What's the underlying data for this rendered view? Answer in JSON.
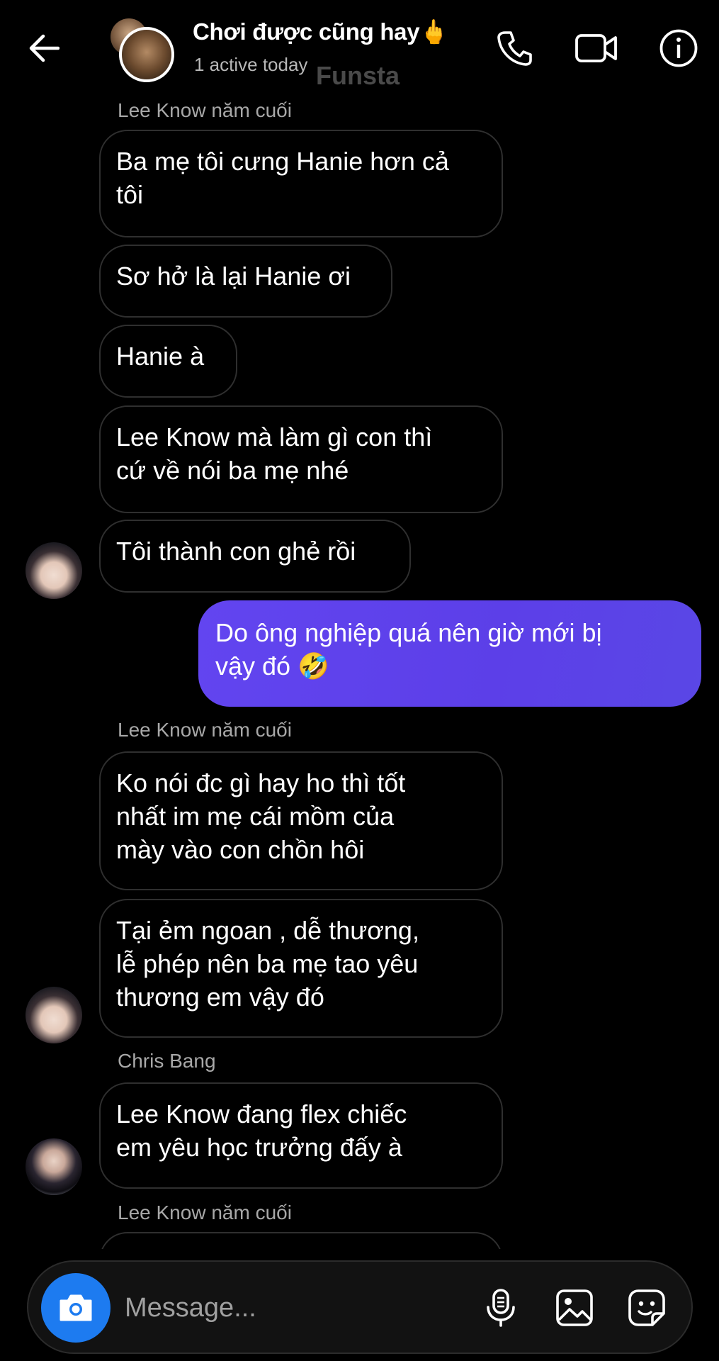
{
  "header": {
    "title": "Chơi được cũng hay🖕",
    "status": "1 active today",
    "watermark": "Funsta"
  },
  "messages": [
    {
      "sender": "Lee Know năm cuối"
    },
    {
      "text": "Ba mẹ tôi cưng Hanie hơn cả\ntôi"
    },
    {
      "text": "Sơ hở là lại Hanie ơi"
    },
    {
      "text": "Hanie à"
    },
    {
      "text": "Lee Know mà làm gì con thì\ncứ về nói ba mẹ nhé"
    },
    {
      "text": "Tôi thành con ghẻ rồi"
    },
    {
      "text": "Do ông nghiệp quá nên giờ mới bị\nvậy đó 🤣"
    },
    {
      "sender": "Lee Know năm cuối"
    },
    {
      "text": "Ko nói đc gì hay ho thì tốt\nnhất im mẹ cái mồm của\nmày vào con chồn hôi"
    },
    {
      "text": "Tại ẻm ngoan , dễ thương,\nlễ phép nên ba mẹ tao yêu\nthương em vậy đó"
    },
    {
      "sender": "Chris Bang"
    },
    {
      "text": "Lee Know đang flex chiếc\nem yêu học trưởng đấy à"
    },
    {
      "sender": "Lee Know năm cuối"
    }
  ],
  "composer": {
    "placeholder": "Message..."
  },
  "colors": {
    "outgoing_bubble": "#5c3fe8",
    "camera_button": "#1d7bf0",
    "background": "#000000"
  },
  "icons": {
    "back": "arrow-left-icon",
    "call": "phone-icon",
    "video": "video-camera-icon",
    "info": "info-icon",
    "camera": "camera-icon",
    "mic": "microphone-icon",
    "gallery": "image-icon",
    "sticker": "sticker-icon"
  }
}
